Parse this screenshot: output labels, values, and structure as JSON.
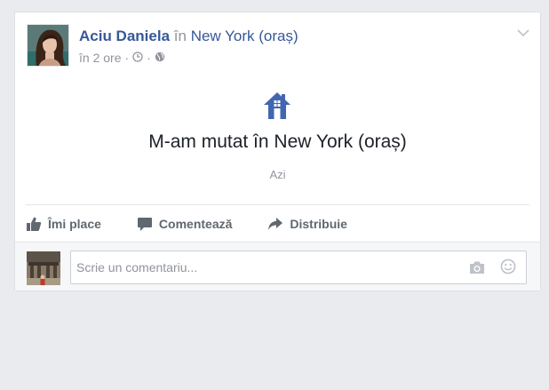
{
  "post": {
    "author": "Aciu Daniela",
    "connector": "în",
    "place": "New York (oraș)",
    "time": "în 2 ore",
    "separator": "·",
    "life_event": {
      "icon": "house-icon",
      "title": "M-am mutat în New York (oraș)",
      "date": "Azi"
    }
  },
  "actions": {
    "like": "Îmi place",
    "comment": "Comentează",
    "share": "Distribuie"
  },
  "comment_box": {
    "placeholder": "Scrie un comentariu..."
  },
  "colors": {
    "link": "#365899",
    "icon_blue": "#4267b2",
    "muted": "#90949c",
    "action_text": "#606770"
  }
}
